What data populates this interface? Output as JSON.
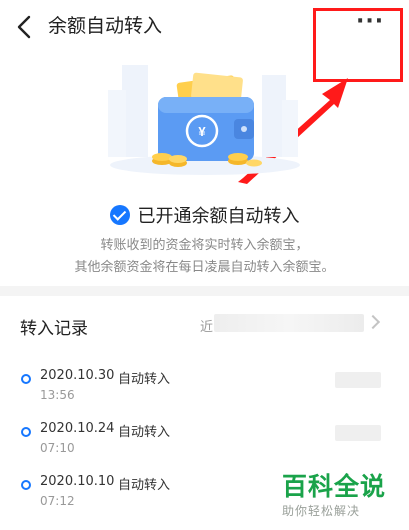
{
  "header": {
    "title": "余额自动转入",
    "more_label": "···"
  },
  "status": {
    "text": "已开通余额自动转入",
    "desc_line1": "转账收到的资金将实时转入余额宝，",
    "desc_line2": "其他余额资金将在每日凌晨自动转入余额宝。"
  },
  "records": {
    "title": "转入记录",
    "filter_prefix": "近",
    "items": [
      {
        "date": "2020.10.30",
        "type": "自动转入",
        "time": "13:56"
      },
      {
        "date": "2020.10.24",
        "type": "自动转入",
        "time": "07:10"
      },
      {
        "date": "2020.10.10",
        "type": "自动转入",
        "time": "07:12"
      }
    ]
  },
  "watermark": {
    "main": "百科全说",
    "sub": "助你轻松解决"
  },
  "colors": {
    "accent": "#1677ff",
    "highlight": "#ff1a1a",
    "watermark": "#1aa34a"
  }
}
